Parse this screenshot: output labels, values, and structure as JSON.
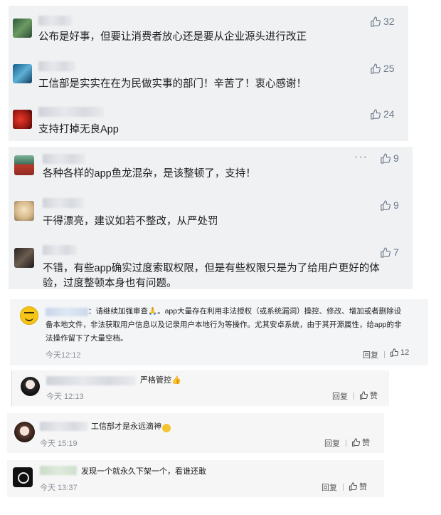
{
  "group1": {
    "comments": [
      {
        "text": "公布是好事，但要让消费者放心还是要从企业源头进行改正",
        "likes": "32"
      },
      {
        "text": "工信部是实实在在为民做实事的部门！辛苦了！衷心感谢！",
        "likes": "25"
      },
      {
        "text": "支持打掉无良App",
        "likes": "24"
      }
    ]
  },
  "group2": {
    "more_label": "···",
    "comments": [
      {
        "text": "各种各样的app鱼龙混杂，是该整顿了，支持！",
        "likes": "9"
      },
      {
        "text": "干得漂亮，建议如若不整改，从严处罚",
        "likes": "9"
      },
      {
        "text_line1": "不错，有些app确实过度索取权限，但是有些权限只是为了给用户更好的体",
        "text_line2": "验，过度整顿本身也有问题。",
        "likes": "7"
      }
    ]
  },
  "group3": {
    "text_line1": "：请继续加强审查🙏。app大量存在利用非法授权（或系统漏洞）操控、修改、增加或者删除设",
    "text_line2": "备本地文件，非法获取用户信息以及记录用户本地行为等操作。尤其安卓系统，由于其开源属性，给app的非",
    "text_line3": "法操作留下了大量空档。",
    "time": "今天12:12",
    "reply": "回复",
    "likes": "12"
  },
  "group4": {
    "text": "严格管控👍",
    "time": "今天 12:13",
    "reply": "回复",
    "like": "赞"
  },
  "group5": {
    "text": "工信部才是永远滴神",
    "time": "今天 15:19",
    "reply": "回复",
    "like": "赞"
  },
  "group6": {
    "text": "发现一个就永久下架一个，看谁还敢",
    "time": "今天 13:37",
    "reply": "回复",
    "like": "赞"
  }
}
